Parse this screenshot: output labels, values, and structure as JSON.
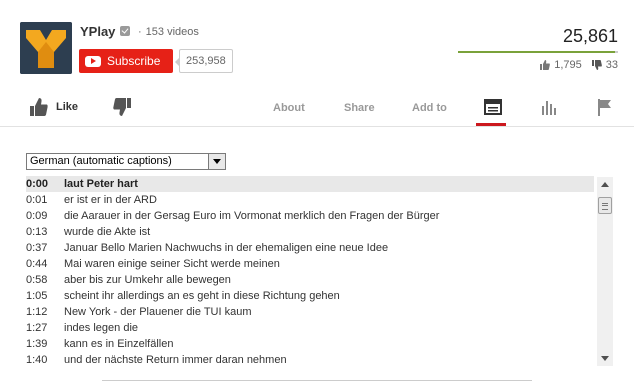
{
  "channel": {
    "name": "YPlay",
    "video_count": "153 videos",
    "subscribe_label": "Subscribe",
    "subscriber_count": "253,958"
  },
  "stats": {
    "views": "25,861",
    "likes": "1,795",
    "dislikes": "33",
    "like_ratio": 0.98,
    "like_bar_color": "#7aa23a"
  },
  "actions": {
    "like_label": "Like",
    "tabs": [
      {
        "label": "About"
      },
      {
        "label": "Share"
      },
      {
        "label": "Add to"
      }
    ],
    "icons": [
      "transcript-icon",
      "statistics-icon",
      "report-flag-icon"
    ],
    "active_tab_color": "#cc181e"
  },
  "transcript": {
    "language": "German (automatic captions)",
    "lines": [
      {
        "time": "0:00",
        "text": "laut Peter hart"
      },
      {
        "time": "0:01",
        "text": "er ist er in der ARD"
      },
      {
        "time": "0:09",
        "text": "die Aarauer in der Gersag Euro im Vormonat merklich den Fragen der Bürger"
      },
      {
        "time": "0:13",
        "text": "wurde die Akte ist"
      },
      {
        "time": "0:37",
        "text": "Januar Bello Marien Nachwuchs in der ehemaligen eine neue Idee"
      },
      {
        "time": "0:44",
        "text": "Mai waren einige seiner Sicht werde meinen"
      },
      {
        "time": "0:58",
        "text": "aber bis zur Umkehr alle bewegen"
      },
      {
        "time": "1:05",
        "text": "scheint ihr allerdings an es geht in diese Richtung gehen"
      },
      {
        "time": "1:12",
        "text": "New York - der Plauener die TUI kaum"
      },
      {
        "time": "1:27",
        "text": "indes legen die"
      },
      {
        "time": "1:39",
        "text": "kann es in Einzelfällen"
      },
      {
        "time": "1:40",
        "text": "und der nächste Return immer daran nehmen"
      }
    ]
  }
}
